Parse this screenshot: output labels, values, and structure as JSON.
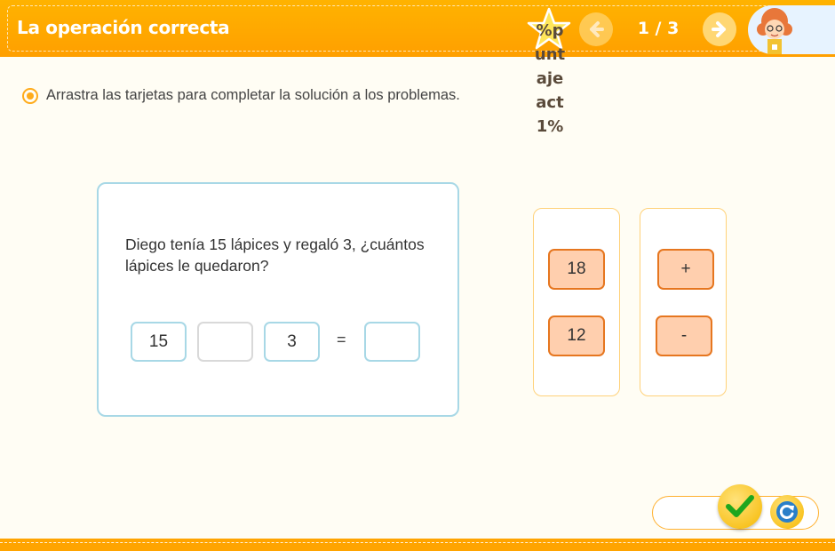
{
  "header": {
    "title": "La operación correcta",
    "score_text": "%puntajeact1%",
    "page_indicator": "1 / 3"
  },
  "instruction": {
    "text": "Arrastra las tarjetas para completar la solución a los problemas."
  },
  "problem": {
    "text": "Diego tenía 15 lápices y regaló 3, ¿cuántos lápices le quedaron?",
    "first_operand": "15",
    "operator": "",
    "second_operand": "3",
    "equals": "=",
    "result": ""
  },
  "number_cards": [
    "18",
    "12"
  ],
  "operator_cards": [
    "+",
    "-"
  ],
  "colors": {
    "header": "#ffa800",
    "card_border": "#a8d8e6",
    "tile_fill": "#ffcfae",
    "tile_border": "#e6761f",
    "check": "#1ea61e",
    "reset": "#2a7fc9"
  },
  "icons": {
    "star": "star-icon",
    "prev": "arrow-left-icon",
    "next": "arrow-right-icon",
    "avatar": "teacher-avatar",
    "check": "check-icon",
    "reset": "reset-icon"
  }
}
